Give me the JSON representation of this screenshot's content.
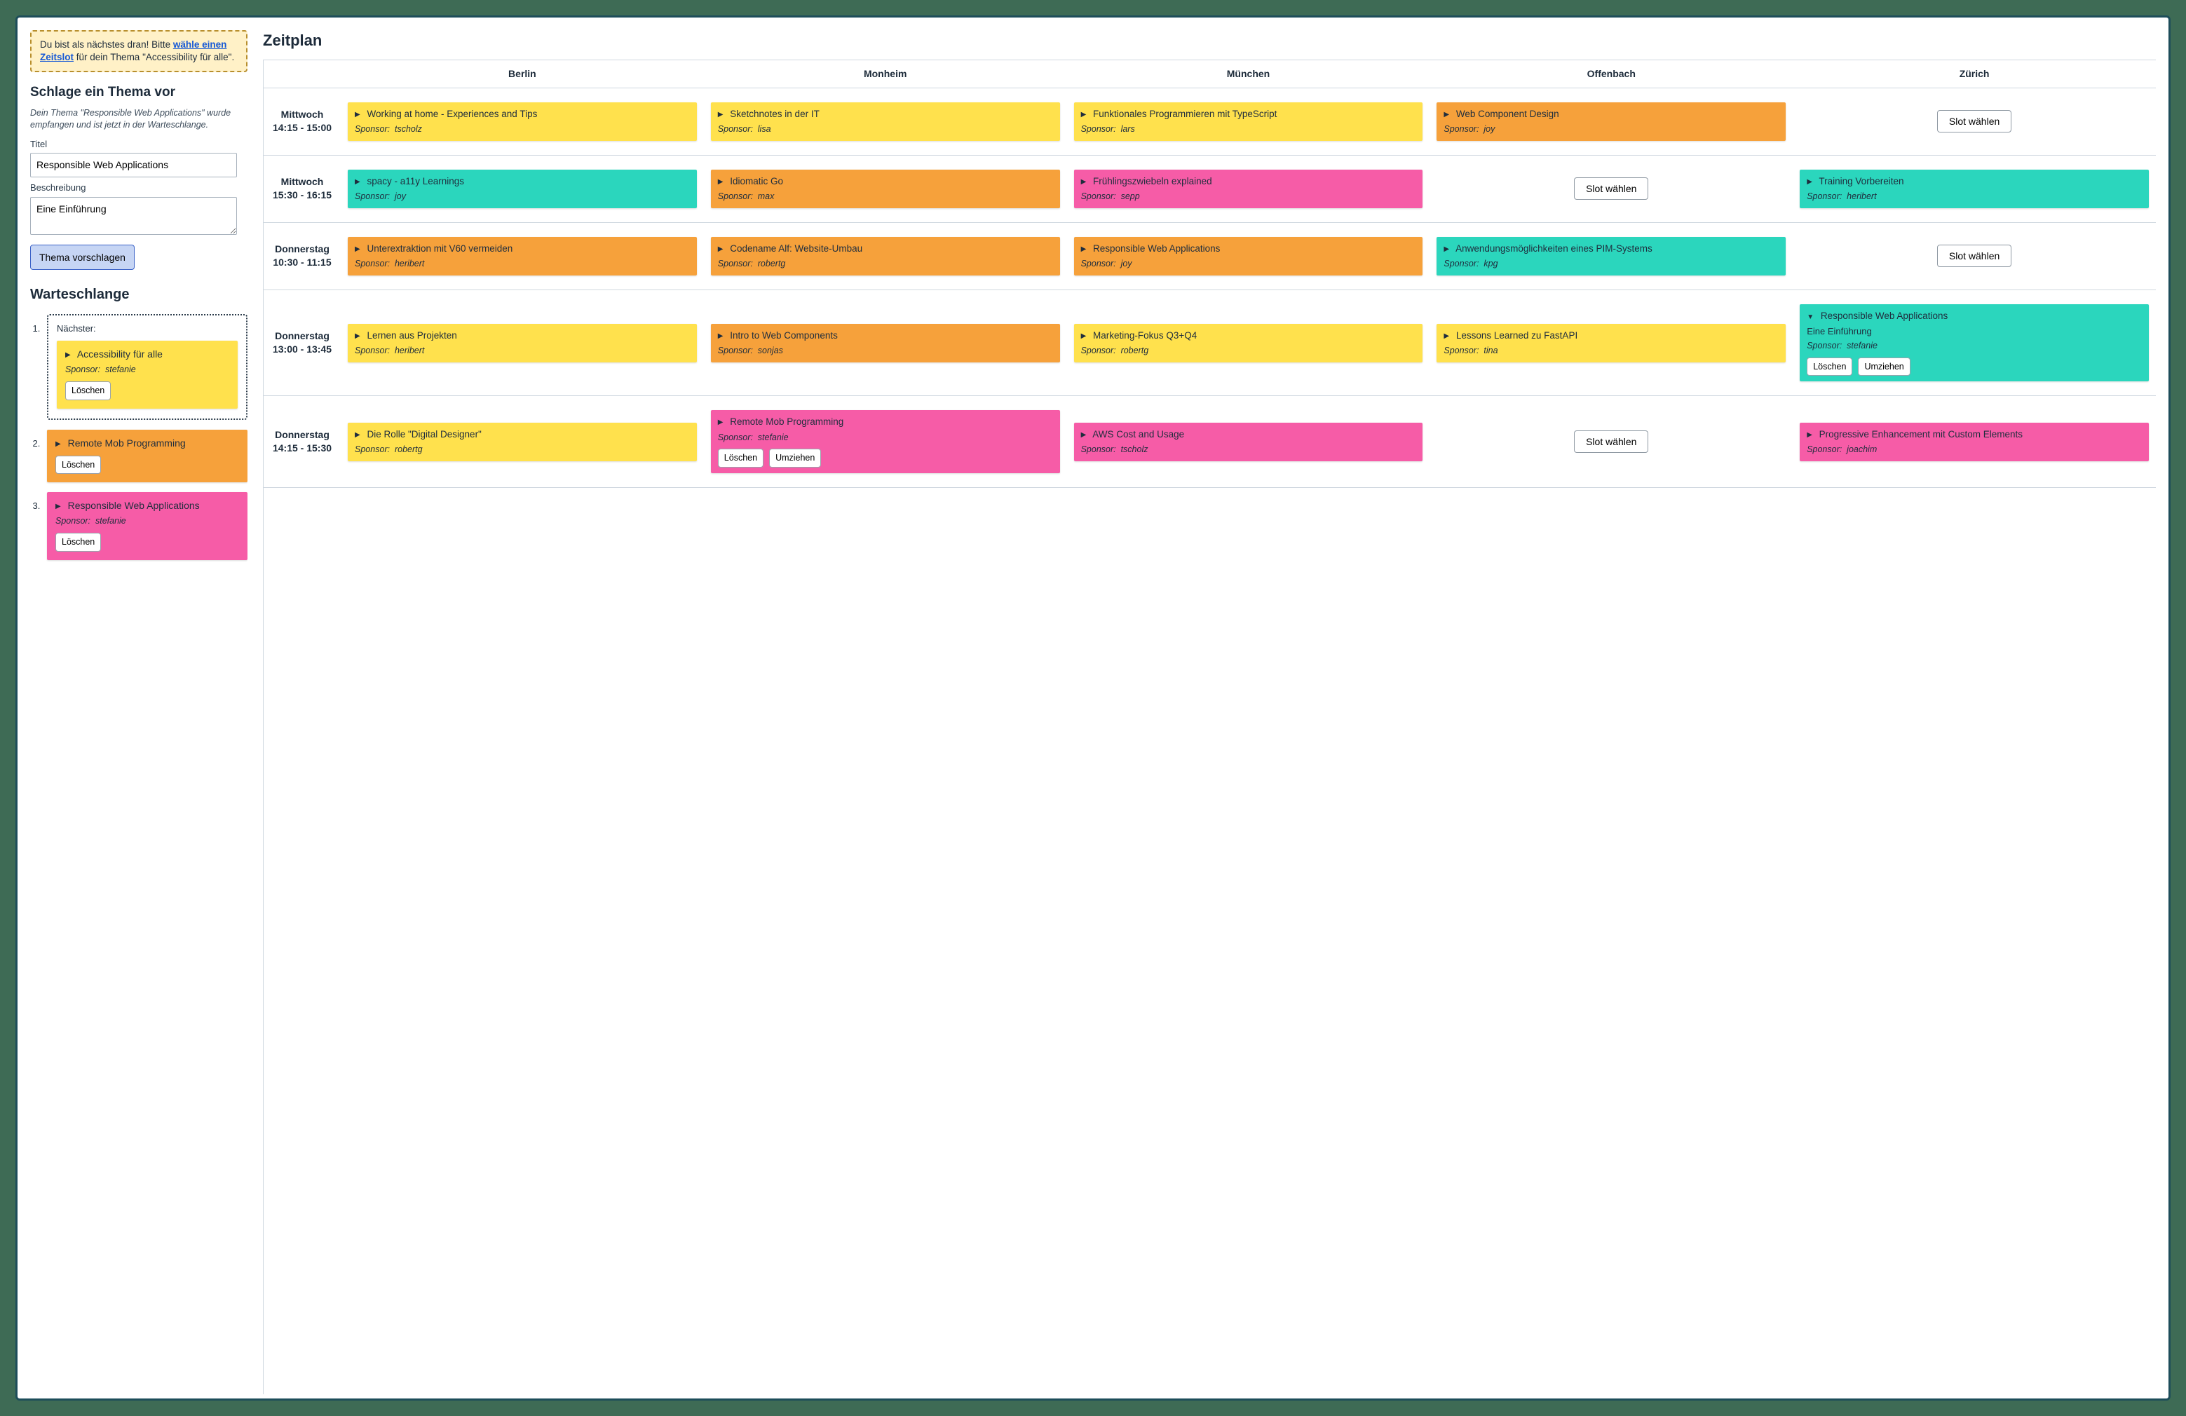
{
  "notice": {
    "prefix": "Du bist als nächstes dran! Bitte ",
    "link": "wähle einen Zeitslot",
    "suffix": " für dein Thema \"Accessibility für alle\"."
  },
  "propose": {
    "heading": "Schlage ein Thema vor",
    "status": "Dein Thema \"Responsible Web Applications\" wurde empfangen und ist jetzt in der Warteschlange.",
    "title_label": "Titel",
    "title_value": "Responsible Web Applications",
    "desc_label": "Beschreibung",
    "desc_value": "Eine Einführung",
    "submit": "Thema vorschlagen"
  },
  "queue": {
    "heading": "Warteschlange",
    "next_label": "Nächster:",
    "delete_label": "Löschen",
    "items": [
      {
        "next": true,
        "color": "c-yellow",
        "title": "Accessibility für alle",
        "sponsor": "stefanie",
        "actions": [
          "delete"
        ]
      },
      {
        "next": false,
        "color": "c-orange",
        "title": "Remote Mob Programming",
        "sponsor": null,
        "actions": [
          "delete"
        ]
      },
      {
        "next": false,
        "color": "c-pink",
        "title": "Responsible Web Applications",
        "sponsor": "stefanie",
        "actions": [
          "delete"
        ]
      }
    ]
  },
  "schedule": {
    "heading": "Zeitplan",
    "rooms": [
      "Berlin",
      "Monheim",
      "München",
      "Offenbach",
      "Zürich"
    ],
    "sponsor_label": "Sponsor:",
    "choose_slot_label": "Slot wählen",
    "delete_label": "Löschen",
    "move_label": "Umziehen",
    "rows": [
      {
        "label": "Mittwoch\n14:15 - 15:00",
        "slots": [
          {
            "type": "card",
            "color": "c-yellow",
            "title": "Working at home - Experiences and Tips",
            "sponsor": "tscholz"
          },
          {
            "type": "card",
            "color": "c-yellow",
            "title": "Sketchnotes in der IT",
            "sponsor": "lisa"
          },
          {
            "type": "card",
            "color": "c-yellow",
            "title": "Funktionales Programmieren mit TypeScript",
            "sponsor": "lars"
          },
          {
            "type": "card",
            "color": "c-orange",
            "title": "Web Component Design",
            "sponsor": "joy"
          },
          {
            "type": "choose"
          }
        ]
      },
      {
        "label": "Mittwoch\n15:30 - 16:15",
        "slots": [
          {
            "type": "card",
            "color": "c-teal",
            "title": "spacy - a11y Learnings",
            "sponsor": "joy"
          },
          {
            "type": "card",
            "color": "c-orange",
            "title": "Idiomatic Go",
            "sponsor": "max"
          },
          {
            "type": "card",
            "color": "c-pink",
            "title": "Frühlingszwiebeln explained",
            "sponsor": "sepp"
          },
          {
            "type": "choose"
          },
          {
            "type": "card",
            "color": "c-teal",
            "title": "Training Vorbereiten",
            "sponsor": "heribert"
          }
        ]
      },
      {
        "label": "Donnerstag\n10:30 - 11:15",
        "slots": [
          {
            "type": "card",
            "color": "c-orange",
            "title": "Unterextraktion mit V60 vermeiden",
            "sponsor": "heribert"
          },
          {
            "type": "card",
            "color": "c-orange",
            "title": "Codename Alf: Website-Umbau",
            "sponsor": "robertg"
          },
          {
            "type": "card",
            "color": "c-orange",
            "title": "Responsible Web Applications",
            "sponsor": "joy"
          },
          {
            "type": "card",
            "color": "c-teal",
            "title": "Anwendungsmöglichkeiten eines PIM-Systems",
            "sponsor": "kpg"
          },
          {
            "type": "choose"
          }
        ]
      },
      {
        "label": "Donnerstag\n13:00 - 13:45",
        "slots": [
          {
            "type": "card",
            "color": "c-yellow",
            "title": "Lernen aus Projekten",
            "sponsor": "heribert"
          },
          {
            "type": "card",
            "color": "c-orange",
            "title": "Intro to Web Components",
            "sponsor": "sonjas"
          },
          {
            "type": "card",
            "color": "c-yellow",
            "title": "Marketing-Fokus Q3+Q4",
            "sponsor": "robertg"
          },
          {
            "type": "card",
            "color": "c-yellow",
            "title": "Lessons Learned zu FastAPI",
            "sponsor": "tina"
          },
          {
            "type": "card",
            "color": "c-teal",
            "title": "Responsible Web Applications",
            "desc": "Eine Einführung",
            "sponsor": "stefanie",
            "expanded": true,
            "actions": [
              "delete",
              "move"
            ]
          }
        ]
      },
      {
        "label": "Donnerstag\n14:15 - 15:30",
        "slots": [
          {
            "type": "card",
            "color": "c-yellow",
            "title": "Die Rolle \"Digital Designer\"",
            "sponsor": "robertg"
          },
          {
            "type": "card",
            "color": "c-pink",
            "title": "Remote Mob Programming",
            "sponsor": "stefanie",
            "actions": [
              "delete",
              "move"
            ]
          },
          {
            "type": "card",
            "color": "c-pink",
            "title": "AWS Cost and Usage",
            "sponsor": "tscholz"
          },
          {
            "type": "choose"
          },
          {
            "type": "card",
            "color": "c-pink",
            "title": "Progressive Enhancement mit Custom Elements",
            "sponsor": "joachim"
          }
        ]
      }
    ]
  }
}
